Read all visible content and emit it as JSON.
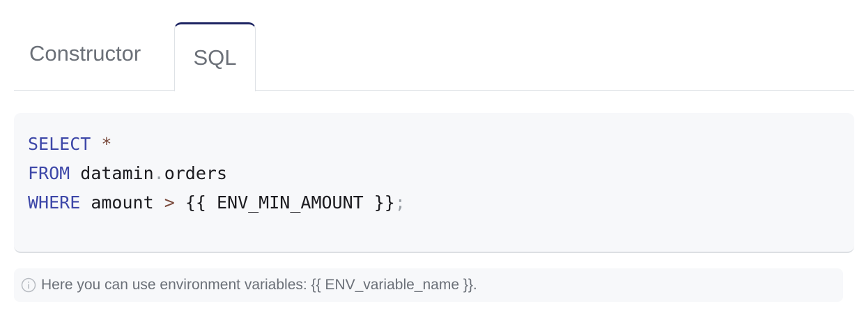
{
  "tabs": [
    {
      "label": "Constructor",
      "active": false
    },
    {
      "label": "SQL",
      "active": true
    }
  ],
  "editor": {
    "lines": [
      {
        "keyword": "SELECT",
        "rest": "*"
      },
      {
        "keyword": "FROM",
        "table_schema": "datamin",
        "dot": ".",
        "table_name": "orders"
      },
      {
        "keyword": "WHERE",
        "column": "amount",
        "operator": ">",
        "variable": "{{ ENV_MIN_AMOUNT }}",
        "terminator": ";"
      }
    ]
  },
  "hint": {
    "icon": "info-icon",
    "text": "Here you can use environment variables: {{ ENV_variable_name }}."
  },
  "colors": {
    "active_tab_accent": "#1e2563",
    "keyword": "#3d47a8",
    "operator": "#7a4a3c"
  }
}
